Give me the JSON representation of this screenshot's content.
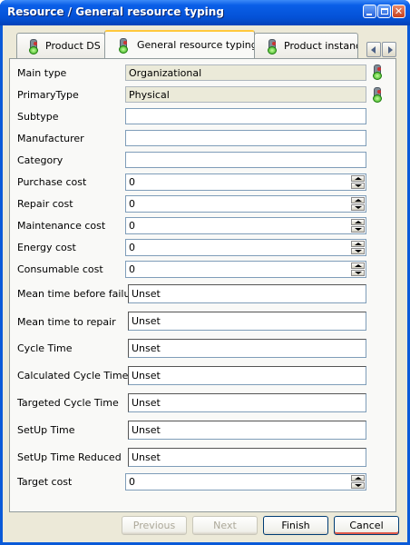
{
  "window": {
    "title": "Resource  /  General resource typing",
    "controls": {
      "minimize": "minimize-icon",
      "maximize": "maximize-icon",
      "close": "close-icon"
    }
  },
  "tabs": [
    {
      "label": "Product DS",
      "icon": "traffic-light-icon"
    },
    {
      "label": "General resource typing",
      "icon": "traffic-light-icon"
    },
    {
      "label": "Product instance",
      "icon": "traffic-light-icon"
    }
  ],
  "form": {
    "main_type": {
      "label": "Main type",
      "value": "Organizational"
    },
    "primary_type": {
      "label": "PrimaryType",
      "value": "Physical"
    },
    "subtype": {
      "label": "Subtype",
      "value": ""
    },
    "manufacturer": {
      "label": "Manufacturer",
      "value": ""
    },
    "category": {
      "label": "Category",
      "value": ""
    },
    "purchase_cost": {
      "label": "Purchase cost",
      "value": "0"
    },
    "repair_cost": {
      "label": "Repair cost",
      "value": "0"
    },
    "maintenance_cost": {
      "label": "Maintenance cost",
      "value": "0"
    },
    "energy_cost": {
      "label": "Energy cost",
      "value": "0"
    },
    "consumable_cost": {
      "label": "Consumable cost",
      "value": "0"
    },
    "mtbf": {
      "label": "Mean time before failure",
      "value": "Unset"
    },
    "mttr": {
      "label": "Mean time to repair",
      "value": "Unset"
    },
    "cycle_time": {
      "label": "Cycle Time",
      "value": "Unset"
    },
    "calculated_cycle_time": {
      "label": "Calculated Cycle Time",
      "value": "Unset"
    },
    "targeted_cycle_time": {
      "label": "Targeted Cycle Time",
      "value": "Unset"
    },
    "setup_time": {
      "label": "SetUp Time",
      "value": "Unset"
    },
    "setup_time_reduced": {
      "label": "SetUp Time Reduced",
      "value": "Unset"
    },
    "target_cost": {
      "label": "Target cost",
      "value": "0"
    }
  },
  "buttons": {
    "previous": "Previous",
    "next": "Next",
    "finish": "Finish",
    "cancel": "Cancel"
  },
  "colors": {
    "title_bar": "#0a5fe8",
    "dialog_bg": "#ece9d8",
    "readonly_field": "#ebead9",
    "traffic_light_green": "#2faa16"
  }
}
